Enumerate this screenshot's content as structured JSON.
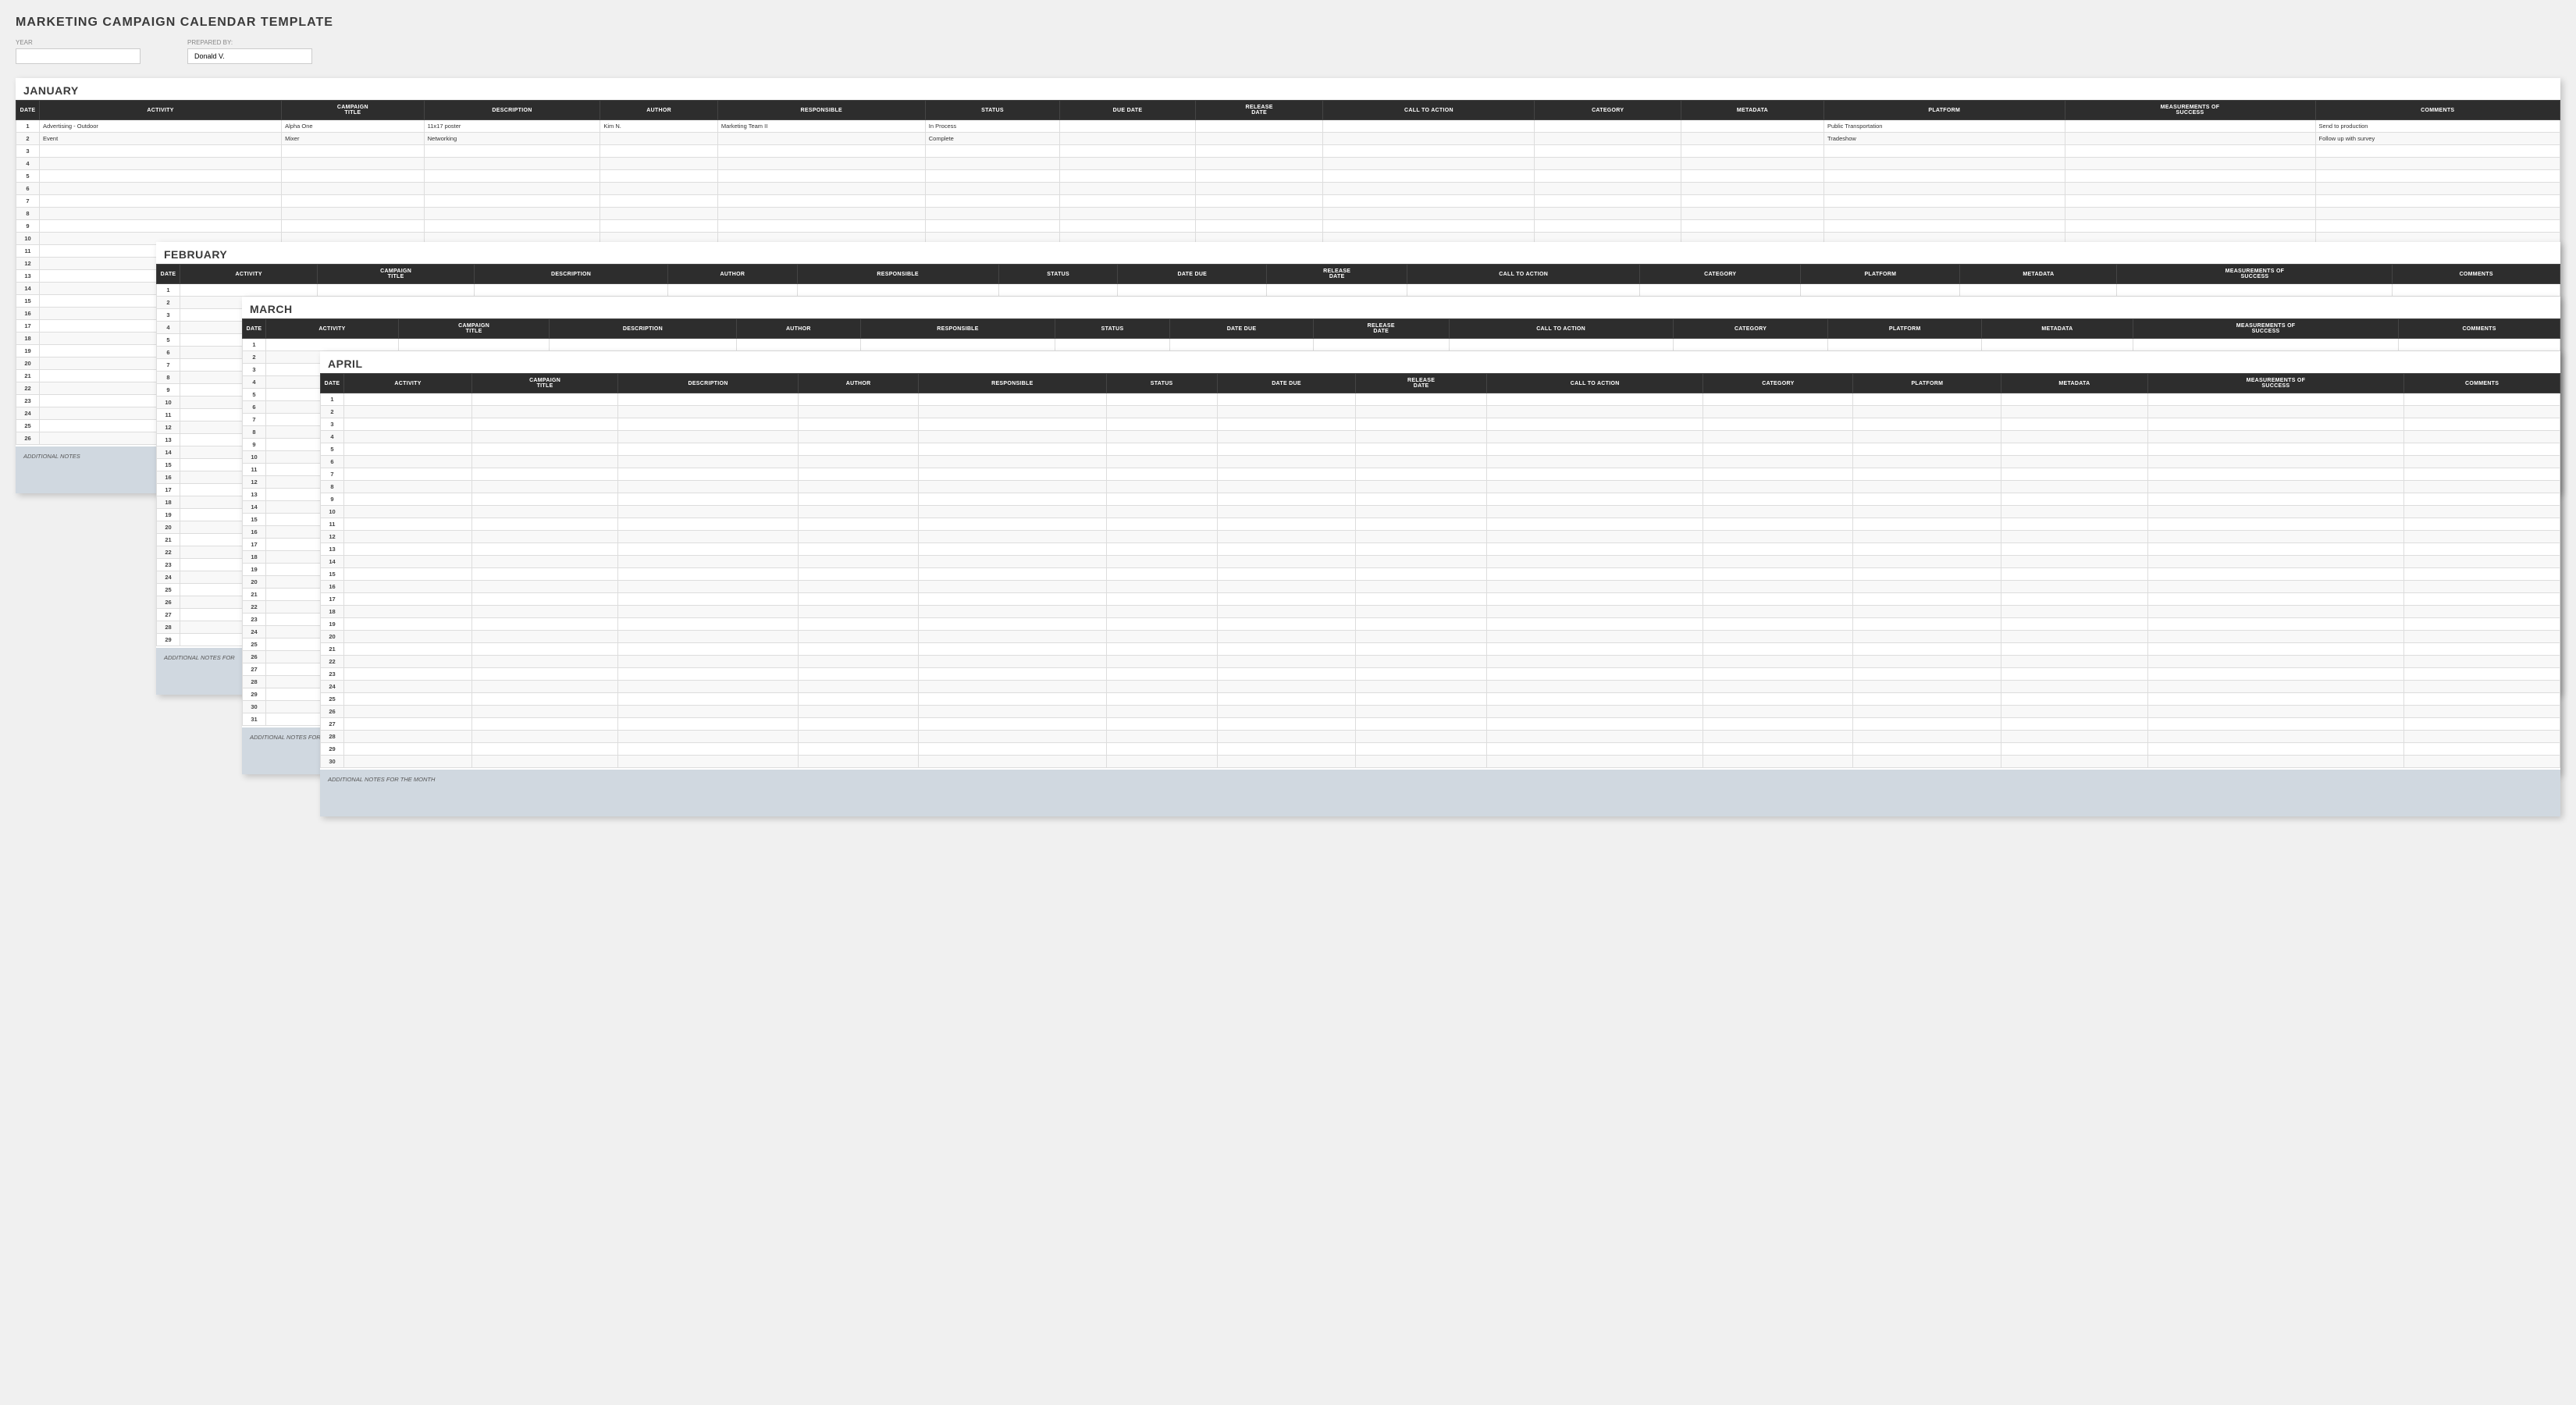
{
  "title": "MARKETING CAMPAIGN CALENDAR TEMPLATE",
  "meta": {
    "year_label": "YEAR",
    "year_value": "",
    "prepared_label": "PREPARED BY:",
    "prepared_value": "Donald V."
  },
  "months": {
    "january": {
      "title": "JANUARY",
      "columns": [
        "DATE",
        "ACTIVITY",
        "CAMPAIGN TITLE",
        "DESCRIPTION",
        "AUTHOR",
        "RESPONSIBLE",
        "STATUS",
        "DUE DATE",
        "RELEASE DATE",
        "CALL TO ACTION",
        "CATEGORY",
        "METADATA",
        "PLATFORM",
        "MEASUREMENTS OF SUCCESS",
        "COMMENTS"
      ],
      "rows": [
        {
          "date": "1",
          "activity": "Advertising - Outdoor",
          "campaign_title": "Alpha One",
          "description": "11x17 poster",
          "author": "Kim N.",
          "responsible": "Marketing Team II",
          "status": "In Process",
          "due_date": "",
          "release_date": "",
          "call_to_action": "",
          "category": "",
          "metadata": "",
          "platform": "Public Transportation",
          "measurements": "",
          "comments": "Send to production"
        },
        {
          "date": "2",
          "activity": "Event",
          "campaign_title": "Mixer",
          "description": "Networking",
          "author": "",
          "responsible": "",
          "status": "Complete",
          "due_date": "",
          "release_date": "",
          "call_to_action": "",
          "category": "",
          "metadata": "",
          "platform": "Tradeshow",
          "measurements": "",
          "comments": "Follow up with survey"
        },
        {
          "date": "3",
          "activity": "",
          "campaign_title": "",
          "description": "",
          "author": "",
          "responsible": "",
          "status": "",
          "due_date": "",
          "release_date": "",
          "call_to_action": "",
          "category": "",
          "metadata": "",
          "platform": "",
          "measurements": "",
          "comments": ""
        },
        {
          "date": "4",
          "activity": "",
          "campaign_title": "",
          "description": "",
          "author": "",
          "responsible": "",
          "status": "",
          "due_date": "",
          "release_date": "",
          "call_to_action": "",
          "category": "",
          "metadata": "",
          "platform": "",
          "measurements": "",
          "comments": ""
        },
        {
          "date": "5",
          "activity": "",
          "campaign_title": "",
          "description": "",
          "author": "",
          "responsible": "",
          "status": "",
          "due_date": "",
          "release_date": "",
          "call_to_action": "",
          "category": "",
          "metadata": "",
          "platform": "",
          "measurements": "",
          "comments": ""
        },
        {
          "date": "6",
          "activity": "",
          "campaign_title": "",
          "description": "",
          "author": "",
          "responsible": "",
          "status": "",
          "due_date": "",
          "release_date": "",
          "call_to_action": "",
          "category": "",
          "metadata": "",
          "platform": "",
          "measurements": "",
          "comments": ""
        },
        {
          "date": "7",
          "activity": "",
          "campaign_title": "",
          "description": "",
          "author": "",
          "responsible": "",
          "status": "",
          "due_date": "",
          "release_date": "",
          "call_to_action": "",
          "category": "",
          "metadata": "",
          "platform": "",
          "measurements": "",
          "comments": ""
        },
        {
          "date": "8",
          "activity": "",
          "campaign_title": "",
          "description": "",
          "author": "",
          "responsible": "",
          "status": "",
          "due_date": "",
          "release_date": "",
          "call_to_action": "",
          "category": "",
          "metadata": "",
          "platform": "",
          "measurements": "",
          "comments": ""
        },
        {
          "date": "9",
          "activity": "",
          "campaign_title": "",
          "description": "",
          "author": "",
          "responsible": "",
          "status": "",
          "due_date": "",
          "release_date": "",
          "call_to_action": "",
          "category": "",
          "metadata": "",
          "platform": "",
          "measurements": "",
          "comments": ""
        },
        {
          "date": "10",
          "activity": "",
          "campaign_title": "",
          "description": "",
          "author": "",
          "responsible": "",
          "status": "",
          "due_date": "",
          "release_date": "",
          "call_to_action": "",
          "category": "",
          "metadata": "",
          "platform": "",
          "measurements": "",
          "comments": ""
        },
        {
          "date": "11",
          "activity": "",
          "campaign_title": "",
          "description": "",
          "author": "",
          "responsible": "",
          "status": "",
          "due_date": "",
          "release_date": "",
          "call_to_action": "",
          "category": "",
          "metadata": "",
          "platform": "",
          "measurements": "",
          "comments": ""
        },
        {
          "date": "12",
          "activity": "",
          "campaign_title": "",
          "description": "",
          "author": "",
          "responsible": "",
          "status": "",
          "due_date": "",
          "release_date": "",
          "call_to_action": "",
          "category": "",
          "metadata": "",
          "platform": "",
          "measurements": "",
          "comments": ""
        },
        {
          "date": "13",
          "activity": "",
          "campaign_title": "",
          "description": "",
          "author": "",
          "responsible": "",
          "status": "",
          "due_date": "",
          "release_date": "",
          "call_to_action": "",
          "category": "",
          "metadata": "",
          "platform": "",
          "measurements": "",
          "comments": ""
        },
        {
          "date": "14",
          "activity": "",
          "campaign_title": "",
          "description": "",
          "author": "",
          "responsible": "",
          "status": "",
          "due_date": "",
          "release_date": "",
          "call_to_action": "",
          "category": "",
          "metadata": "",
          "platform": "",
          "measurements": "",
          "comments": ""
        },
        {
          "date": "15",
          "activity": "",
          "campaign_title": "",
          "description": "",
          "author": "",
          "responsible": "",
          "status": "",
          "due_date": "",
          "release_date": "",
          "call_to_action": "",
          "category": "",
          "metadata": "",
          "platform": "",
          "measurements": "",
          "comments": ""
        },
        {
          "date": "16",
          "activity": "",
          "campaign_title": "",
          "description": "",
          "author": "",
          "responsible": "",
          "status": "",
          "due_date": "",
          "release_date": "",
          "call_to_action": "",
          "category": "",
          "metadata": "",
          "platform": "",
          "measurements": "",
          "comments": ""
        },
        {
          "date": "17",
          "activity": "",
          "campaign_title": "",
          "description": "",
          "author": "",
          "responsible": "",
          "status": "",
          "due_date": "",
          "release_date": "",
          "call_to_action": "",
          "category": "",
          "metadata": "",
          "platform": "",
          "measurements": "",
          "comments": ""
        },
        {
          "date": "18",
          "activity": "",
          "campaign_title": "",
          "description": "",
          "author": "",
          "responsible": "",
          "status": "",
          "due_date": "",
          "release_date": "",
          "call_to_action": "",
          "category": "",
          "metadata": "",
          "platform": "",
          "measurements": "",
          "comments": ""
        },
        {
          "date": "19",
          "activity": "",
          "campaign_title": "",
          "description": "",
          "author": "",
          "responsible": "",
          "status": "",
          "due_date": "",
          "release_date": "",
          "call_to_action": "",
          "category": "",
          "metadata": "",
          "platform": "",
          "measurements": "",
          "comments": ""
        },
        {
          "date": "20",
          "activity": "",
          "campaign_title": "",
          "description": "",
          "author": "",
          "responsible": "",
          "status": "",
          "due_date": "",
          "release_date": "",
          "call_to_action": "",
          "category": "",
          "metadata": "",
          "platform": "",
          "measurements": "",
          "comments": ""
        },
        {
          "date": "21",
          "activity": "",
          "campaign_title": "",
          "description": "",
          "author": "",
          "responsible": "",
          "status": "",
          "due_date": "",
          "release_date": "",
          "call_to_action": "",
          "category": "",
          "metadata": "",
          "platform": "",
          "measurements": "",
          "comments": ""
        },
        {
          "date": "22",
          "activity": "",
          "campaign_title": "",
          "description": "",
          "author": "",
          "responsible": "",
          "status": "",
          "due_date": "",
          "release_date": "",
          "call_to_action": "",
          "category": "",
          "metadata": "",
          "platform": "",
          "measurements": "",
          "comments": ""
        },
        {
          "date": "23",
          "activity": "",
          "campaign_title": "",
          "description": "",
          "author": "",
          "responsible": "",
          "status": "",
          "due_date": "",
          "release_date": "",
          "call_to_action": "",
          "category": "",
          "metadata": "",
          "platform": "",
          "measurements": "",
          "comments": ""
        },
        {
          "date": "24",
          "activity": "",
          "campaign_title": "",
          "description": "",
          "author": "",
          "responsible": "",
          "status": "",
          "due_date": "",
          "release_date": "",
          "call_to_action": "",
          "category": "",
          "metadata": "",
          "platform": "",
          "measurements": "",
          "comments": ""
        },
        {
          "date": "25",
          "activity": "",
          "campaign_title": "",
          "description": "",
          "author": "",
          "responsible": "",
          "status": "",
          "due_date": "",
          "release_date": "",
          "call_to_action": "",
          "category": "",
          "metadata": "",
          "platform": "",
          "measurements": "",
          "comments": ""
        },
        {
          "date": "26",
          "activity": "",
          "campaign_title": "",
          "description": "",
          "author": "",
          "responsible": "",
          "status": "",
          "due_date": "",
          "release_date": "",
          "call_to_action": "",
          "category": "",
          "metadata": "",
          "platform": "",
          "measurements": "",
          "comments": ""
        }
      ],
      "notes_label": "ADDITIONAL NOTES"
    },
    "february": {
      "title": "FEBRUARY",
      "columns": [
        "DATE",
        "ACTIVITY",
        "CAMPAIGN TITLE",
        "DESCRIPTION",
        "AUTHOR",
        "RESPONSIBLE",
        "STATUS",
        "DATE DUE",
        "RELEASE DATE",
        "CALL TO ACTION",
        "CATEGORY",
        "PLATFORM",
        "METADATA",
        "MEASUREMENTS OF SUCCESS",
        "COMMENTS"
      ],
      "row_count": 29,
      "notes_label": "ADDITIONAL NOTES FOR"
    },
    "march": {
      "title": "MARCH",
      "columns": [
        "DATE",
        "ACTIVITY",
        "CAMPAIGN TITLE",
        "DESCRIPTION",
        "AUTHOR",
        "RESPONSIBLE",
        "STATUS",
        "DATE DUE",
        "RELEASE DATE",
        "CALL TO ACTION",
        "CATEGORY",
        "PLATFORM",
        "METADATA",
        "MEASUREMENTS OF SUCCESS",
        "COMMENTS"
      ],
      "row_count": 31,
      "notes_label": "ADDITIONAL NOTES FOR"
    },
    "april": {
      "title": "APRIL",
      "columns": [
        "DATE",
        "ACTIVITY",
        "CAMPAIGN TITLE",
        "DESCRIPTION",
        "AUTHOR",
        "RESPONSIBLE",
        "STATUS",
        "DATE DUE",
        "RELEASE DATE",
        "CALL TO ACTION",
        "CATEGORY",
        "PLATFORM",
        "METADATA",
        "MEASUREMENTS OF SUCCESS",
        "COMMENTS"
      ],
      "row_count": 30,
      "notes_label": "ADDITIONAL NOTES FOR THE MONTH"
    }
  }
}
